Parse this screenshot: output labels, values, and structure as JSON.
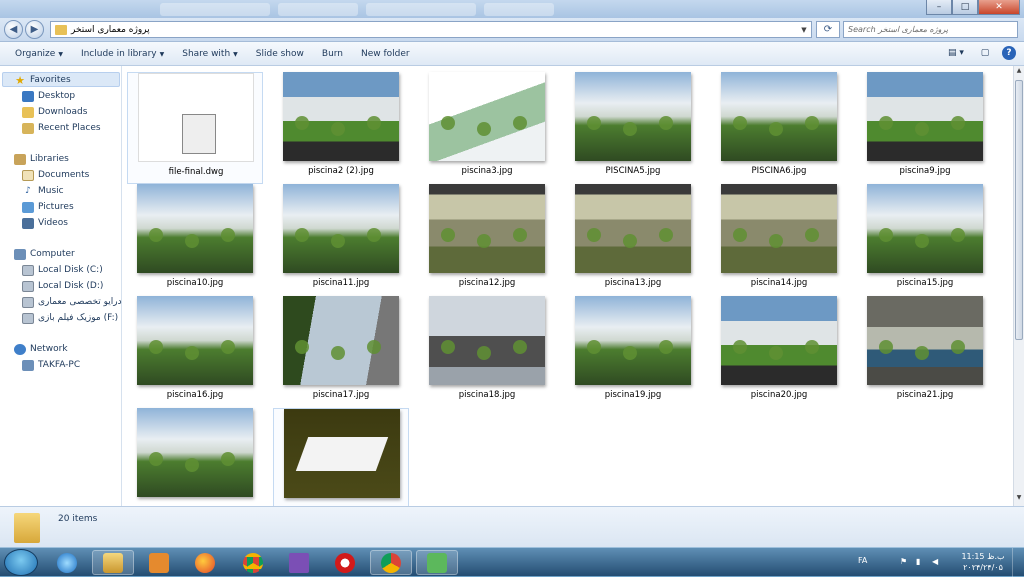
{
  "window": {
    "address_path": "پروژه معماری استخر",
    "search_placeholder": "Search پروژه معماری استخر",
    "controls": {
      "minimize": "–",
      "maximize": "□",
      "close": "✕"
    }
  },
  "toolbar": {
    "organize": "Organize",
    "include_in_library": "Include in library",
    "share_with": "Share with",
    "slide_show": "Slide show",
    "burn": "Burn",
    "new_folder": "New folder"
  },
  "nav": {
    "favorites": "Favorites",
    "desktop": "Desktop",
    "downloads": "Downloads",
    "recent_places": "Recent Places",
    "libraries": "Libraries",
    "documents": "Documents",
    "music": "Music",
    "pictures": "Pictures",
    "videos": "Videos",
    "computer": "Computer",
    "local_c": "Local Disk (C:)",
    "local_d": "Local Disk (D:)",
    "drive_e": "درایو تخصصی معماری",
    "drive_f": "موزیک فیلم بازی (F:)",
    "network": "Network",
    "takfa_pc": "TAKFA-PC"
  },
  "files": [
    {
      "name": "file-final.dwg",
      "kind": "dwg"
    },
    {
      "name": "piscina2 (2).jpg",
      "kind": "ext-day"
    },
    {
      "name": "piscina3.jpg",
      "kind": "aerial"
    },
    {
      "name": "PISCINA5.jpg",
      "kind": "ext-cloud"
    },
    {
      "name": "PISCINA6.jpg",
      "kind": "ext-cloud"
    },
    {
      "name": "piscina9.jpg",
      "kind": "ext-day"
    },
    {
      "name": "piscina10.jpg",
      "kind": "ext-cloud"
    },
    {
      "name": "piscina11.jpg",
      "kind": "ext-cloud"
    },
    {
      "name": "piscina12.jpg",
      "kind": "interior"
    },
    {
      "name": "piscina13.jpg",
      "kind": "interior"
    },
    {
      "name": "piscina14.jpg",
      "kind": "interior"
    },
    {
      "name": "piscina15.jpg",
      "kind": "ext-cloud"
    },
    {
      "name": "piscina16.jpg",
      "kind": "ext-cloud"
    },
    {
      "name": "piscina17.jpg",
      "kind": "corridor"
    },
    {
      "name": "piscina18.jpg",
      "kind": "hall"
    },
    {
      "name": "piscina19.jpg",
      "kind": "ext-cloud"
    },
    {
      "name": "piscina20.jpg",
      "kind": "ext-day"
    },
    {
      "name": "piscina21.jpg",
      "kind": "pool"
    },
    {
      "name": "",
      "kind": "ext-cloud"
    },
    {
      "name": "",
      "kind": "model"
    }
  ],
  "status": {
    "item_count": "20 items"
  },
  "taskbar": {
    "language": "FA",
    "clock_time": "11:15 ب.ظ",
    "clock_date": "۲۰۲۴/۲۴/۰۵"
  }
}
